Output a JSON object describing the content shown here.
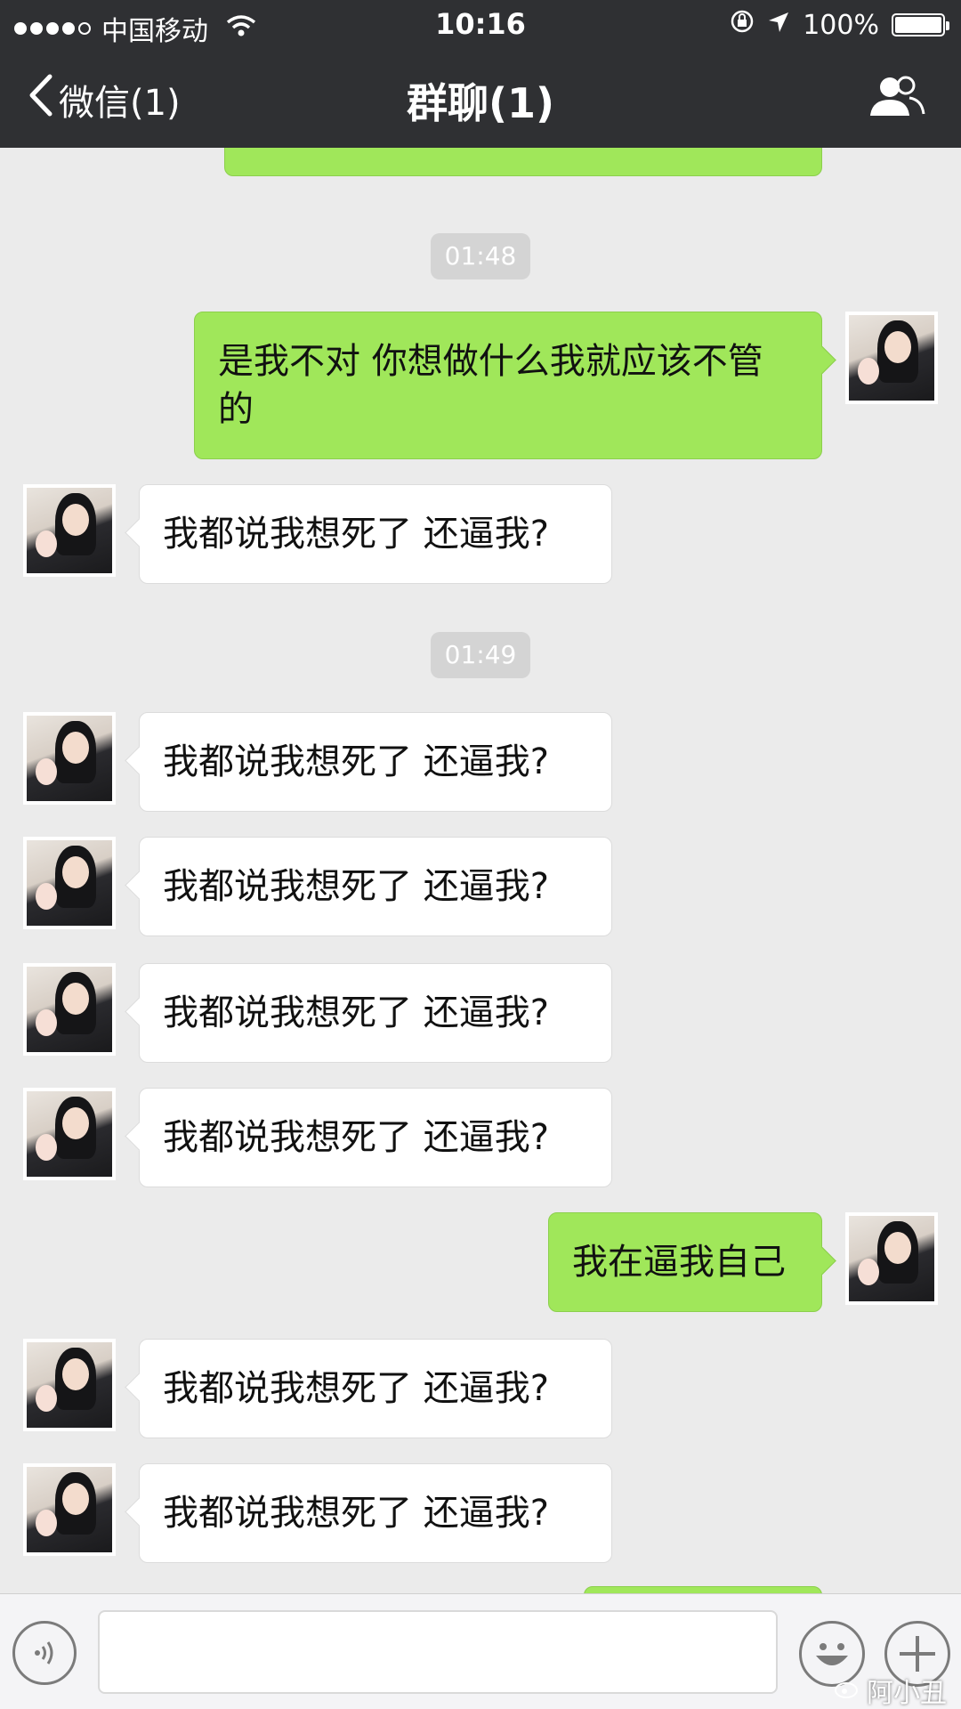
{
  "status_bar": {
    "carrier": "中国移动",
    "time": "10:16",
    "battery": "100%",
    "signal_filled": 4,
    "signal_total": 5
  },
  "nav": {
    "back_label": "微信(1)",
    "title": "群聊(1)"
  },
  "timestamps": [
    "01:48",
    "01:49"
  ],
  "messages": [
    {
      "side": "out",
      "text": "是我不对 你想做什么我就应该不管的"
    },
    {
      "side": "in",
      "text": "我都说我想死了 还逼我?"
    },
    {
      "side": "in",
      "text": "我都说我想死了 还逼我?"
    },
    {
      "side": "in",
      "text": "我都说我想死了 还逼我?"
    },
    {
      "side": "in",
      "text": "我都说我想死了 还逼我?"
    },
    {
      "side": "in",
      "text": "我都说我想死了 还逼我?"
    },
    {
      "side": "out",
      "text": "我在逼我自己"
    },
    {
      "side": "in",
      "text": "我都说我想死了 还逼我?"
    },
    {
      "side": "in",
      "text": "我都说我想死了 还逼我?"
    }
  ],
  "input_bar": {
    "input_value": "",
    "watermark": "阿小丑"
  },
  "colors": {
    "header_bg": "#2f3033",
    "chat_bg": "#ebebeb",
    "outgoing_bubble": "#a0e75a",
    "incoming_bubble": "#ffffff"
  },
  "icons": [
    "chevron-left-icon",
    "members-icon",
    "wifi-icon",
    "lock-rotation-icon",
    "location-arrow-icon",
    "battery-icon",
    "voice-icon",
    "emoji-icon",
    "plus-icon"
  ]
}
